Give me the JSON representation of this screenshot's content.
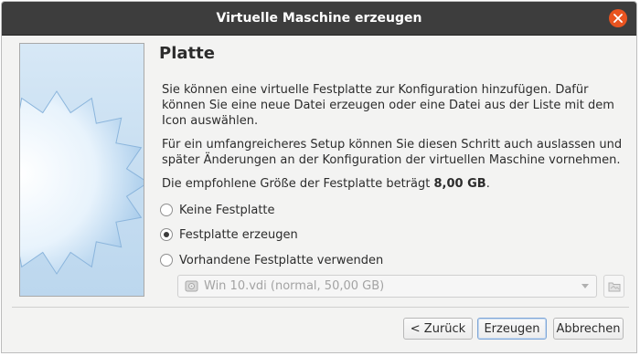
{
  "window": {
    "title": "Virtuelle Maschine erzeugen"
  },
  "page": {
    "title": "Platte",
    "paragraph1": "Sie können eine virtuelle Festplatte zur Konfiguration hinzufügen. Dafür können Sie eine neue Datei erzeugen oder eine Datei aus der Liste mit dem Icon auswählen.",
    "paragraph2": "Für ein umfangreicheres Setup können Sie diesen Schritt auch auslassen und später Änderungen an der Konfiguration der virtuellen Maschine vornehmen.",
    "recommended_prefix": "Die empfohlene Größe der Festplatte beträgt",
    "recommended_size": "8,00 GB",
    "recommended_suffix": "."
  },
  "options": [
    {
      "label": "Keine Festplatte",
      "checked": false
    },
    {
      "label": "Festplatte erzeugen",
      "checked": true
    },
    {
      "label": "Vorhandene Festplatte verwenden",
      "checked": false
    }
  ],
  "existing_disk": {
    "selected": "Win 10.vdi (normal, 50,00 GB)",
    "enabled": false
  },
  "buttons": {
    "back": "< Zurück",
    "create": "Erzeugen",
    "cancel": "Abbrechen"
  },
  "colors": {
    "titlebar": "#3d3d3d",
    "close_button": "#e95420",
    "default_button_border": "#7ea6d7"
  },
  "icons": {
    "close": "close-icon",
    "disk": "hard-disk-icon",
    "dropdown": "chevron-down-icon",
    "browse": "folder-browse-icon",
    "wizard_image": "starburst-illustration"
  }
}
